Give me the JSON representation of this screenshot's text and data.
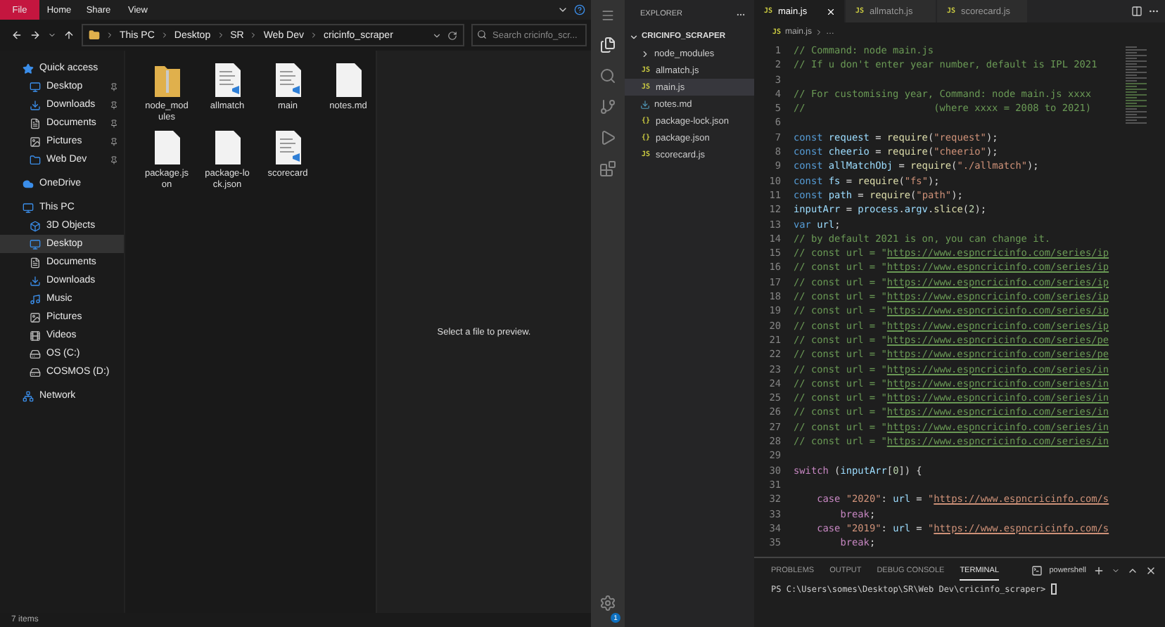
{
  "file_explorer": {
    "ribbon": {
      "tabs": [
        {
          "label": "File",
          "selected": true
        },
        {
          "label": "Home",
          "selected": false
        },
        {
          "label": "Share",
          "selected": false
        },
        {
          "label": "View",
          "selected": false
        }
      ]
    },
    "address_bar": {
      "path": [
        "This PC",
        "Desktop",
        "SR",
        "Web Dev",
        "cricinfo_scraper"
      ],
      "search": {
        "placeholder": "Search cricinfo_scr..."
      }
    },
    "navigation": [
      {
        "label": "Quick access",
        "kind": "star",
        "selected": false,
        "children": [
          {
            "label": "Desktop",
            "kind": "desktop",
            "selected": false,
            "pinned": true
          },
          {
            "label": "Downloads",
            "kind": "download",
            "selected": false,
            "pinned": true
          },
          {
            "label": "Documents",
            "kind": "document",
            "selected": false,
            "pinned": true
          },
          {
            "label": "Pictures",
            "kind": "picture",
            "selected": false,
            "pinned": true
          },
          {
            "label": "Web Dev",
            "kind": "folder",
            "selected": false,
            "pinned": true
          }
        ]
      },
      {
        "label": "OneDrive",
        "kind": "cloud",
        "selected": false
      },
      {
        "label": "This PC",
        "kind": "pc",
        "selected": false,
        "children": [
          {
            "label": "3D Objects",
            "kind": "cube",
            "selected": false,
            "pinned": false
          },
          {
            "label": "Desktop",
            "kind": "desktop",
            "selected": true,
            "pinned": false
          },
          {
            "label": "Documents",
            "kind": "document",
            "selected": false,
            "pinned": false
          },
          {
            "label": "Downloads",
            "kind": "download",
            "selected": false,
            "pinned": false
          },
          {
            "label": "Music",
            "kind": "music",
            "selected": false,
            "pinned": false
          },
          {
            "label": "Pictures",
            "kind": "picture",
            "selected": false,
            "pinned": false
          },
          {
            "label": "Videos",
            "kind": "video",
            "selected": false,
            "pinned": false
          },
          {
            "label": "OS (C:)",
            "kind": "drive",
            "selected": false,
            "pinned": false
          },
          {
            "label": "COSMOS (D:)",
            "kind": "drive",
            "selected": false,
            "pinned": false
          }
        ]
      },
      {
        "label": "Network",
        "kind": "network",
        "selected": false
      }
    ],
    "files": [
      {
        "name": "node_modules",
        "kind": "folder"
      },
      {
        "name": "allmatch",
        "kind": "script"
      },
      {
        "name": "main",
        "kind": "script"
      },
      {
        "name": "notes.md",
        "kind": "blank"
      },
      {
        "name": "package.json",
        "kind": "blank"
      },
      {
        "name": "package-lock.json",
        "kind": "blank"
      },
      {
        "name": "scorecard",
        "kind": "script"
      }
    ],
    "preview": {
      "message": "Select a file to preview."
    },
    "status_bar": {
      "items": "7 items"
    }
  },
  "code_editor": {
    "activity_bar": {
      "settings_badge": "1"
    },
    "sidebar": {
      "title": "EXPLORER",
      "folder": {
        "name": "CRICINFO_SCRAPER",
        "expanded": true
      },
      "items": [
        {
          "name": "node_modules",
          "kind": "folder",
          "selected": false
        },
        {
          "name": "allmatch.js",
          "kind": "badge",
          "badge": "JS",
          "selected": false
        },
        {
          "name": "main.js",
          "kind": "badge",
          "badge": "JS",
          "selected": true
        },
        {
          "name": "notes.md",
          "kind": "md",
          "selected": false
        },
        {
          "name": "package-lock.json",
          "kind": "badge",
          "badge": "{}",
          "selected": false
        },
        {
          "name": "package.json",
          "kind": "badge",
          "badge": "{}",
          "selected": false
        },
        {
          "name": "scorecard.js",
          "kind": "badge",
          "badge": "JS",
          "selected": false
        }
      ]
    },
    "tabs": [
      {
        "label": "main.js",
        "badge": "JS",
        "selected": true
      },
      {
        "label": "allmatch.js",
        "badge": "JS",
        "selected": false
      },
      {
        "label": "scorecard.js",
        "badge": "JS",
        "selected": false
      }
    ],
    "breadcrumb": {
      "badge": "JS",
      "items": [
        "main.js",
        "…"
      ]
    },
    "lines": [
      {
        "n": "1",
        "tokens": [
          {
            "text": "// Command: node main.js",
            "kind": "comment"
          }
        ]
      },
      {
        "n": "2",
        "tokens": [
          {
            "text": "// If u don't enter year number, default is IPL 2021",
            "kind": "comment"
          }
        ]
      },
      {
        "n": "3"
      },
      {
        "n": "4",
        "tokens": [
          {
            "text": "// For customising year, Command: node main.js xxxx",
            "kind": "comment"
          }
        ]
      },
      {
        "n": "5",
        "tokens": [
          {
            "text": "//                      (where xxxx = 2008 to 2021)",
            "kind": "comment"
          }
        ]
      },
      {
        "n": "6"
      },
      {
        "n": "7",
        "tokens": [
          {
            "text": "const ",
            "kind": "keyword"
          },
          {
            "text": "request",
            "kind": "variable"
          },
          {
            "text": " = ",
            "kind": "plain"
          },
          {
            "text": "require",
            "kind": "function"
          },
          {
            "text": "(",
            "kind": "plain"
          },
          {
            "text": "\"request\"",
            "kind": "string"
          },
          {
            "text": ");",
            "kind": "plain"
          }
        ]
      },
      {
        "n": "8",
        "tokens": [
          {
            "text": "const ",
            "kind": "keyword"
          },
          {
            "text": "cheerio",
            "kind": "variable"
          },
          {
            "text": " = ",
            "kind": "plain"
          },
          {
            "text": "require",
            "kind": "function"
          },
          {
            "text": "(",
            "kind": "plain"
          },
          {
            "text": "\"cheerio\"",
            "kind": "string"
          },
          {
            "text": ");",
            "kind": "plain"
          }
        ]
      },
      {
        "n": "9",
        "tokens": [
          {
            "text": "const ",
            "kind": "keyword"
          },
          {
            "text": "allMatchObj",
            "kind": "variable"
          },
          {
            "text": " = ",
            "kind": "plain"
          },
          {
            "text": "require",
            "kind": "function"
          },
          {
            "text": "(",
            "kind": "plain"
          },
          {
            "text": "\"./allmatch\"",
            "kind": "string"
          },
          {
            "text": ");",
            "kind": "plain"
          }
        ]
      },
      {
        "n": "10",
        "tokens": [
          {
            "text": "const ",
            "kind": "keyword"
          },
          {
            "text": "fs",
            "kind": "variable"
          },
          {
            "text": " = ",
            "kind": "plain"
          },
          {
            "text": "require",
            "kind": "function"
          },
          {
            "text": "(",
            "kind": "plain"
          },
          {
            "text": "\"fs\"",
            "kind": "string"
          },
          {
            "text": ");",
            "kind": "plain"
          }
        ]
      },
      {
        "n": "11",
        "tokens": [
          {
            "text": "const ",
            "kind": "keyword"
          },
          {
            "text": "path",
            "kind": "variable"
          },
          {
            "text": " = ",
            "kind": "plain"
          },
          {
            "text": "require",
            "kind": "function"
          },
          {
            "text": "(",
            "kind": "plain"
          },
          {
            "text": "\"path\"",
            "kind": "string"
          },
          {
            "text": ");",
            "kind": "plain"
          }
        ]
      },
      {
        "n": "12",
        "tokens": [
          {
            "text": "inputArr",
            "kind": "variable"
          },
          {
            "text": " = ",
            "kind": "plain"
          },
          {
            "text": "process",
            "kind": "variable"
          },
          {
            "text": ".",
            "kind": "plain"
          },
          {
            "text": "argv",
            "kind": "variable"
          },
          {
            "text": ".",
            "kind": "plain"
          },
          {
            "text": "slice",
            "kind": "function"
          },
          {
            "text": "(",
            "kind": "plain"
          },
          {
            "text": "2",
            "kind": "number"
          },
          {
            "text": ");",
            "kind": "plain"
          }
        ]
      },
      {
        "n": "13",
        "tokens": [
          {
            "text": "var ",
            "kind": "keyword"
          },
          {
            "text": "url",
            "kind": "variable"
          },
          {
            "text": ";",
            "kind": "plain"
          }
        ]
      },
      {
        "n": "14",
        "tokens": [
          {
            "text": "// by default 2021 is on, you can change it.",
            "kind": "comment"
          }
        ]
      },
      {
        "n": "15",
        "tokens": [
          {
            "text": "// const url = \"",
            "kind": "comment"
          },
          {
            "text": "https://www.espncricinfo.com/series/ip",
            "kind": "link"
          }
        ]
      },
      {
        "n": "16",
        "tokens": [
          {
            "text": "// const url = \"",
            "kind": "comment"
          },
          {
            "text": "https://www.espncricinfo.com/series/ip",
            "kind": "link"
          }
        ]
      },
      {
        "n": "17",
        "tokens": [
          {
            "text": "// const url = \"",
            "kind": "comment"
          },
          {
            "text": "https://www.espncricinfo.com/series/ip",
            "kind": "link"
          }
        ]
      },
      {
        "n": "18",
        "tokens": [
          {
            "text": "// const url = \"",
            "kind": "comment"
          },
          {
            "text": "https://www.espncricinfo.com/series/ip",
            "kind": "link"
          }
        ]
      },
      {
        "n": "19",
        "tokens": [
          {
            "text": "// const url = \"",
            "kind": "comment"
          },
          {
            "text": "https://www.espncricinfo.com/series/ip",
            "kind": "link"
          }
        ]
      },
      {
        "n": "20",
        "tokens": [
          {
            "text": "// const url = \"",
            "kind": "comment"
          },
          {
            "text": "https://www.espncricinfo.com/series/ip",
            "kind": "link"
          }
        ]
      },
      {
        "n": "21",
        "tokens": [
          {
            "text": "// const url = \"",
            "kind": "comment"
          },
          {
            "text": "https://www.espncricinfo.com/series/pe",
            "kind": "link"
          }
        ]
      },
      {
        "n": "22",
        "tokens": [
          {
            "text": "// const url = \"",
            "kind": "comment"
          },
          {
            "text": "https://www.espncricinfo.com/series/pe",
            "kind": "link"
          }
        ]
      },
      {
        "n": "23",
        "tokens": [
          {
            "text": "// const url = \"",
            "kind": "comment"
          },
          {
            "text": "https://www.espncricinfo.com/series/in",
            "kind": "link"
          }
        ]
      },
      {
        "n": "24",
        "tokens": [
          {
            "text": "// const url = \"",
            "kind": "comment"
          },
          {
            "text": "https://www.espncricinfo.com/series/in",
            "kind": "link"
          }
        ]
      },
      {
        "n": "25",
        "tokens": [
          {
            "text": "// const url = \"",
            "kind": "comment"
          },
          {
            "text": "https://www.espncricinfo.com/series/in",
            "kind": "link"
          }
        ]
      },
      {
        "n": "26",
        "tokens": [
          {
            "text": "// const url = \"",
            "kind": "comment"
          },
          {
            "text": "https://www.espncricinfo.com/series/in",
            "kind": "link"
          }
        ]
      },
      {
        "n": "27",
        "tokens": [
          {
            "text": "// const url = \"",
            "kind": "comment"
          },
          {
            "text": "https://www.espncricinfo.com/series/in",
            "kind": "link"
          }
        ]
      },
      {
        "n": "28",
        "tokens": [
          {
            "text": "// const url = \"",
            "kind": "comment"
          },
          {
            "text": "https://www.espncricinfo.com/series/in",
            "kind": "link"
          }
        ]
      },
      {
        "n": "29"
      },
      {
        "n": "30",
        "tokens": [
          {
            "text": "switch",
            "kind": "control"
          },
          {
            "text": " (",
            "kind": "plain"
          },
          {
            "text": "inputArr",
            "kind": "variable"
          },
          {
            "text": "[",
            "kind": "plain"
          },
          {
            "text": "0",
            "kind": "number"
          },
          {
            "text": "]) {",
            "kind": "plain"
          }
        ]
      },
      {
        "n": "31"
      },
      {
        "n": "32",
        "tokens": [
          {
            "text": "    case ",
            "kind": "control"
          },
          {
            "text": "\"2020\"",
            "kind": "string"
          },
          {
            "text": ": ",
            "kind": "plain"
          },
          {
            "text": "url",
            "kind": "variable"
          },
          {
            "text": " = ",
            "kind": "plain"
          },
          {
            "text": "\"",
            "kind": "string"
          },
          {
            "text": "https://www.espncricinfo.com/s",
            "kind": "string-link"
          }
        ]
      },
      {
        "n": "33",
        "tokens": [
          {
            "text": "        break",
            "kind": "control"
          },
          {
            "text": ";",
            "kind": "plain"
          }
        ]
      },
      {
        "n": "34",
        "tokens": [
          {
            "text": "    case ",
            "kind": "control"
          },
          {
            "text": "\"2019\"",
            "kind": "string"
          },
          {
            "text": ": ",
            "kind": "plain"
          },
          {
            "text": "url",
            "kind": "variable"
          },
          {
            "text": " = ",
            "kind": "plain"
          },
          {
            "text": "\"",
            "kind": "string"
          },
          {
            "text": "https://www.espncricinfo.com/s",
            "kind": "string-link"
          }
        ]
      },
      {
        "n": "35",
        "tokens": [
          {
            "text": "        break",
            "kind": "control"
          },
          {
            "text": ";",
            "kind": "plain"
          }
        ]
      }
    ],
    "panel": {
      "tabs": [
        {
          "label": "PROBLEMS",
          "selected": false
        },
        {
          "label": "OUTPUT",
          "selected": false
        },
        {
          "label": "DEBUG CONSOLE",
          "selected": false
        },
        {
          "label": "TERMINAL",
          "selected": true
        }
      ],
      "shell": "powershell",
      "prompt": "PS C:\\Users\\somes\\Desktop\\SR\\Web Dev\\cricinfo_scraper> "
    }
  }
}
